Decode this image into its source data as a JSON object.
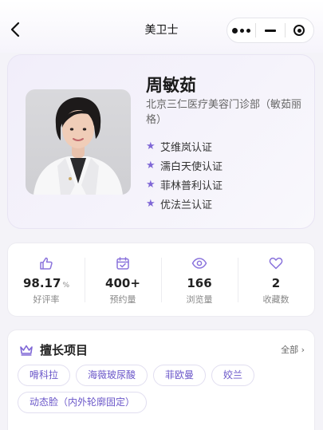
{
  "nav": {
    "title": "美卫士",
    "back_icon": "chevron-left-icon",
    "menu_icon": "more-dots-icon",
    "minimize_icon": "minus-icon",
    "close_icon": "target-icon"
  },
  "profile": {
    "name": "周敏茹",
    "hospital": "北京三仁医疗美容门诊部（敏茹丽格）",
    "certifications": [
      "艾维岚认证",
      "濡白天使认证",
      "菲林普利认证",
      "优法兰认证"
    ],
    "accent_color": "#7f67d6"
  },
  "stats": [
    {
      "icon": "thumbs-up-icon",
      "value": "98.17",
      "unit": "%",
      "label": "好评率"
    },
    {
      "icon": "calendar-check-icon",
      "value": "400+",
      "unit": "",
      "label": "预约量"
    },
    {
      "icon": "eye-icon",
      "value": "166",
      "unit": "",
      "label": "浏览量"
    },
    {
      "icon": "heart-icon",
      "value": "2",
      "unit": "",
      "label": "收藏数"
    }
  ],
  "specialties": {
    "title": "擅长项目",
    "all_label": "全部 ›",
    "icon": "crown-icon",
    "tags": [
      "嗗科拉",
      "海薇玻尿酸",
      "菲欧曼",
      "姣兰",
      "动态脸（内外轮廓固定）"
    ]
  }
}
